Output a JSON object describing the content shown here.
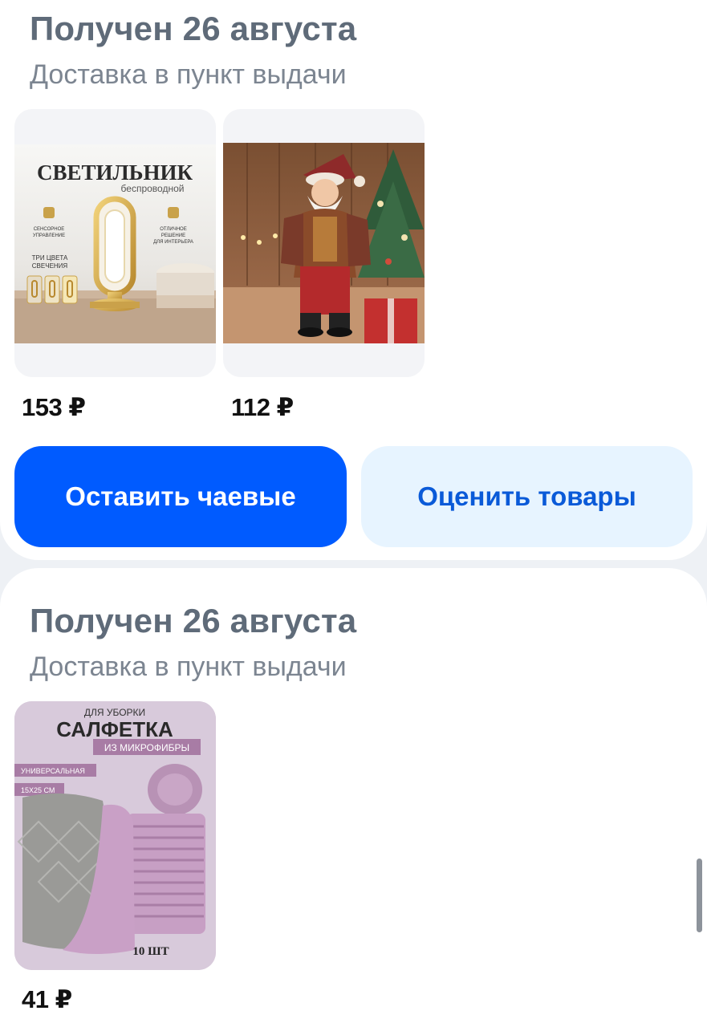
{
  "orders": [
    {
      "title": "Получен 26 августа",
      "subtitle": "Доставка в пункт выдачи",
      "items": [
        {
          "price": "153 ₽",
          "image_text": {
            "heading": "СВЕТИЛЬНИК",
            "sub": "беспроводной",
            "feature_1a": "СЕНСОРНОЕ",
            "feature_1b": "УПРАВЛЕНИЕ",
            "feature_2a": "ОТЛИЧНОЕ",
            "feature_2b": "РЕШЕНИЕ",
            "feature_2c": "ДЛЯ ИНТЕРЬЕРА",
            "feature_3a": "ТРИ ЦВЕТА",
            "feature_3b": "СВЕЧЕНИЯ"
          }
        },
        {
          "price": "112 ₽"
        }
      ],
      "buttons": {
        "tips": "Оставить чаевые",
        "rate": "Оценить товары"
      }
    },
    {
      "title": "Получен 26 августа",
      "subtitle": "Доставка в пункт выдачи",
      "items": [
        {
          "price": "41 ₽",
          "image_text": {
            "top": "ДЛЯ УБОРКИ",
            "heading": "САЛФЕТКА",
            "material": "ИЗ МИКРОФИБРЫ",
            "tag_1": "УНИВЕРСАЛЬНАЯ",
            "tag_2": "15X25 СМ",
            "count": "10 ШТ"
          }
        }
      ]
    }
  ],
  "colors": {
    "primary_button": "#005bff",
    "secondary_button": "#e7f4ff",
    "secondary_button_text": "#0a5ad8",
    "title_text": "#5f6b79",
    "subtitle_text": "#7c8591",
    "page_bg": "#eef1f5"
  }
}
